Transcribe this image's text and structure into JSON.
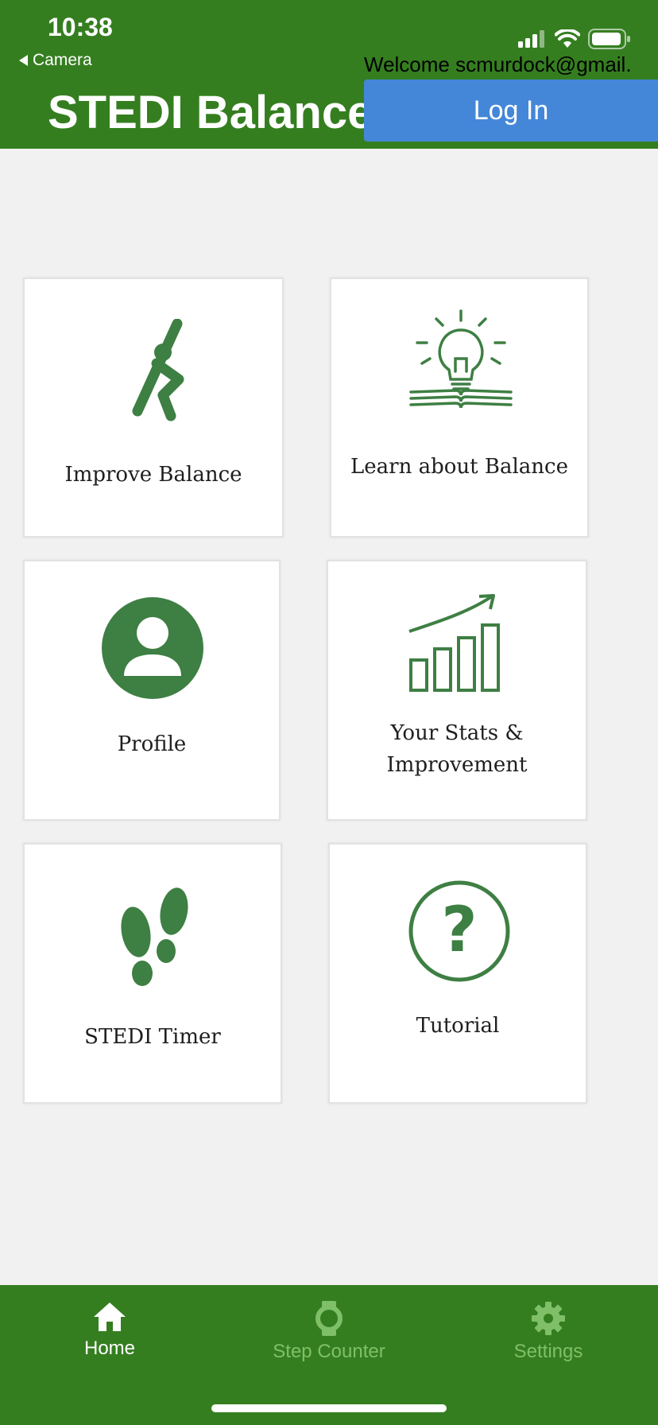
{
  "status_bar": {
    "time": "10:38",
    "back_label": "Camera",
    "icons": [
      "signal-icon",
      "wifi-icon",
      "battery-icon"
    ]
  },
  "header": {
    "title": "STEDI Balance",
    "welcome": "Welcome scmurdock@gmail.",
    "login_label": "Log In"
  },
  "tiles": [
    {
      "label": "Improve Balance",
      "icon": "stretching-person-icon"
    },
    {
      "label": "Learn about Balance",
      "icon": "lightbulb-book-icon"
    },
    {
      "label": "Profile",
      "icon": "profile-avatar-icon"
    },
    {
      "label_line1": "Your Stats &",
      "label_line2": "Improvement",
      "icon": "stats-chart-icon"
    },
    {
      "label": "STEDI Timer",
      "icon": "footsteps-icon"
    },
    {
      "label": "Tutorial",
      "icon": "question-circle-icon"
    }
  ],
  "tabbar": {
    "items": [
      {
        "label": "Home",
        "icon": "home-icon",
        "active": true
      },
      {
        "label": "Step Counter",
        "icon": "watch-icon",
        "active": false
      },
      {
        "label": "Settings",
        "icon": "gear-icon",
        "active": false
      }
    ]
  },
  "colors": {
    "brand_green": "#357e20",
    "icon_green": "#3e7f43",
    "login_blue": "#4487d8",
    "background": "#f1f1f1",
    "inactive_tab": "#7fbf68"
  }
}
